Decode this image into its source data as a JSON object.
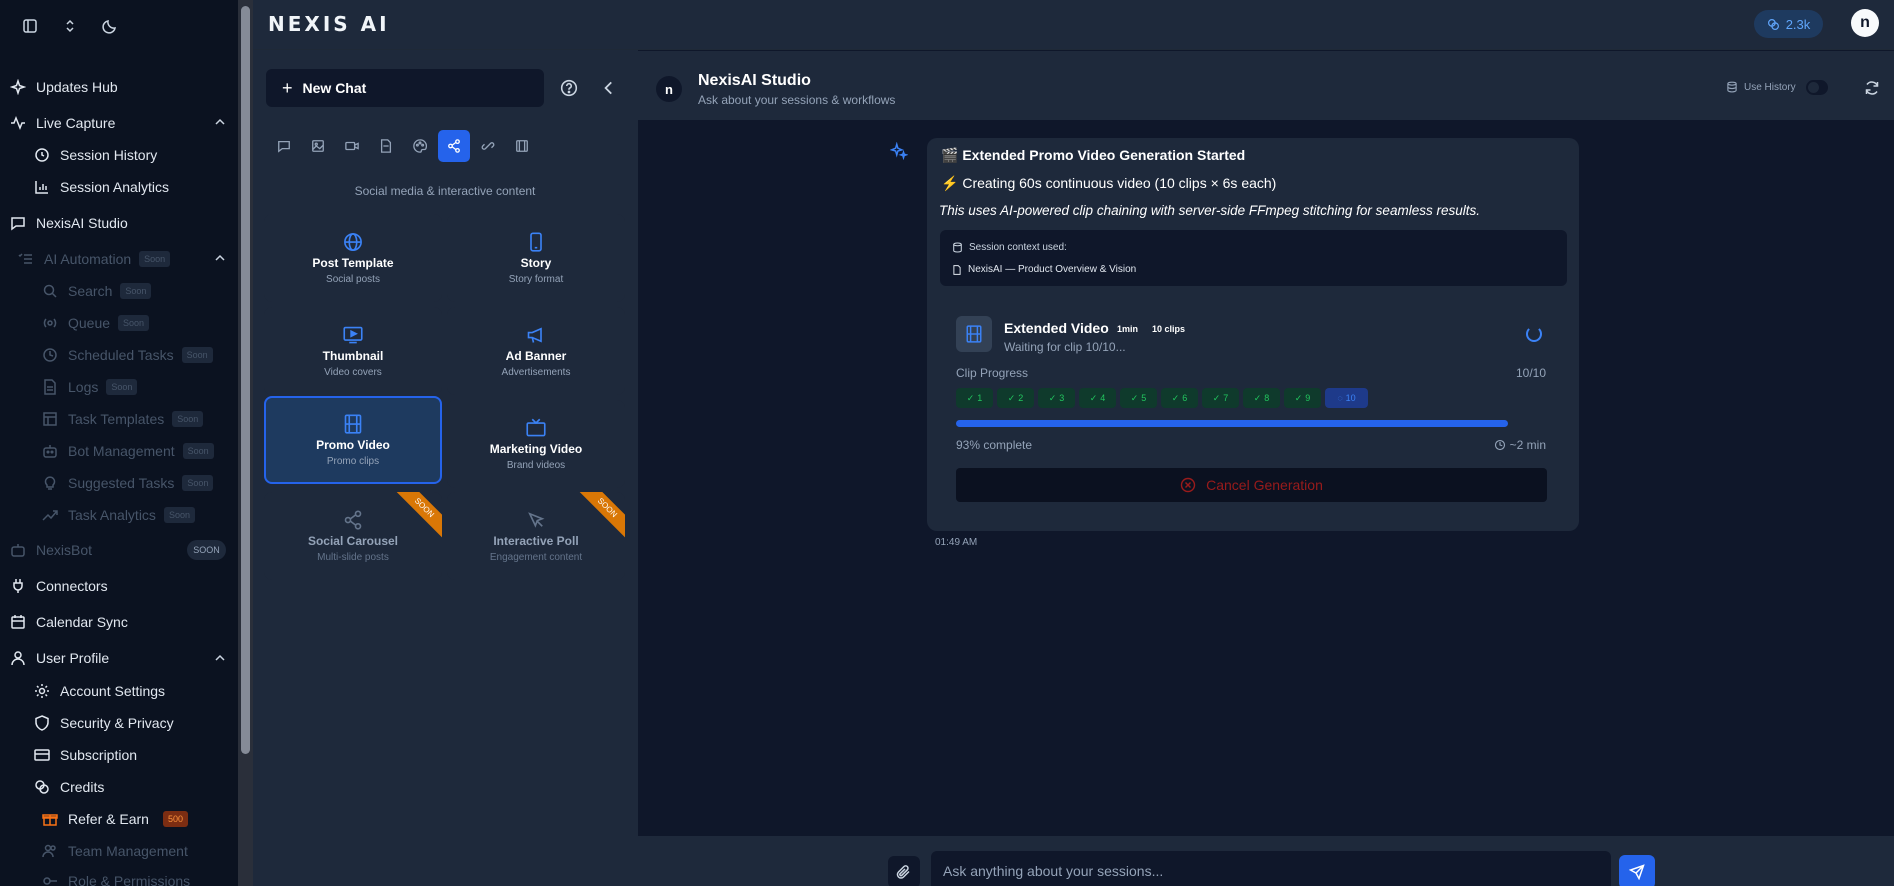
{
  "app": {
    "logo": "NEXIS AI",
    "credits_count": "2.3k",
    "avatar_letter": "n"
  },
  "sidebar": {
    "updates_hub": "Updates Hub",
    "live_capture": "Live Capture",
    "session_history": "Session History",
    "session_analytics": "Session Analytics",
    "nexisai_studio": "NexisAI Studio",
    "ai_automation": "AI Automation",
    "search": "Search",
    "queue": "Queue",
    "scheduled_tasks": "Scheduled Tasks",
    "logs": "Logs",
    "task_templates": "Task Templates",
    "bot_management": "Bot Management",
    "suggested_tasks": "Suggested Tasks",
    "task_analytics": "Task Analytics",
    "nexisbot": "NexisBot",
    "connectors": "Connectors",
    "calendar_sync": "Calendar Sync",
    "user_profile": "User Profile",
    "account_settings": "Account Settings",
    "security_privacy": "Security & Privacy",
    "subscription": "Subscription",
    "credits": "Credits",
    "refer_earn": "Refer & Earn",
    "refer_badge": "500",
    "team_management": "Team Management",
    "role_permissions": "Role & Permissions",
    "soon_label": "Soon",
    "soon_upper": "SOON"
  },
  "panel": {
    "new_chat": "New Chat",
    "category_desc": "Social media & interactive content",
    "cards": [
      {
        "title": "Post Template",
        "subtitle": "Social posts"
      },
      {
        "title": "Story",
        "subtitle": "Story format"
      },
      {
        "title": "Thumbnail",
        "subtitle": "Video covers"
      },
      {
        "title": "Ad Banner",
        "subtitle": "Advertisements"
      },
      {
        "title": "Promo Video",
        "subtitle": "Promo clips"
      },
      {
        "title": "Marketing Video",
        "subtitle": "Brand videos"
      },
      {
        "title": "Social Carousel",
        "subtitle": "Multi-slide posts"
      },
      {
        "title": "Interactive Poll",
        "subtitle": "Engagement content"
      }
    ],
    "ribbon_label": "SOON"
  },
  "chat": {
    "title": "NexisAI Studio",
    "subtitle": "Ask about your sessions & workflows",
    "use_history": "Use History",
    "message": {
      "title": "🎬 Extended Promo Video Generation Started",
      "line": "Creating 60s continuous video (10 clips × 6s each)",
      "italic": "This uses AI-powered clip chaining with server-side FFmpeg stitching for seamless results.",
      "context_label": "Session context used:",
      "context_item": "NexisAI — Product Overview & Vision",
      "video_title": "Extended Video",
      "tag_duration": "1min",
      "tag_clips": "10 clips",
      "status": "Waiting for clip 10/10...",
      "clip_progress_label": "Clip Progress",
      "clip_count": "10/10",
      "clips": [
        "1",
        "2",
        "3",
        "4",
        "5",
        "6",
        "7",
        "8",
        "9",
        "10"
      ],
      "progress": 0.93,
      "percent_text": "93% complete",
      "eta": "~2 min",
      "cancel": "Cancel Generation",
      "timestamp": "01:49 AM"
    },
    "input_placeholder": "Ask anything about your sessions..."
  }
}
